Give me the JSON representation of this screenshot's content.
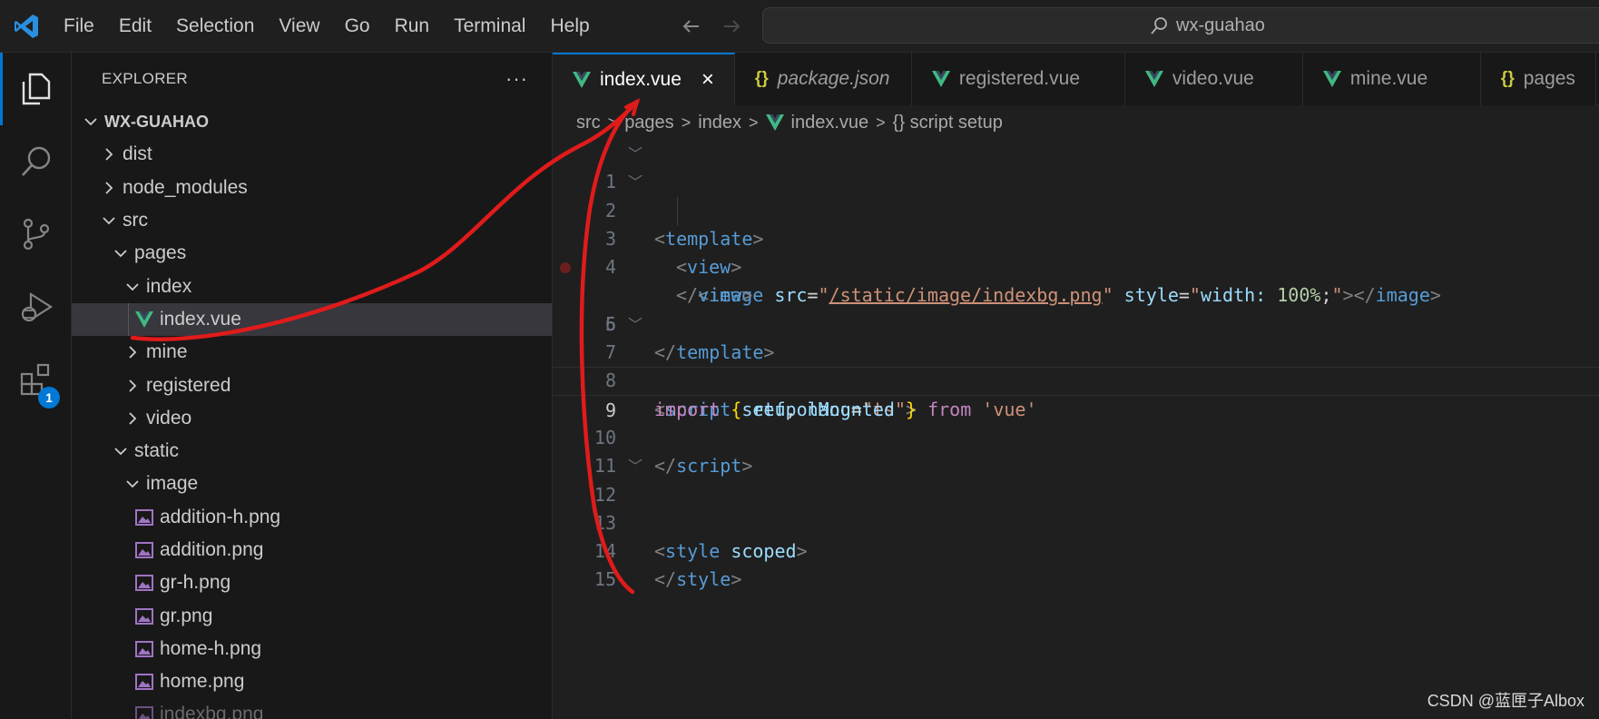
{
  "menu": [
    "File",
    "Edit",
    "Selection",
    "View",
    "Go",
    "Run",
    "Terminal",
    "Help"
  ],
  "search": {
    "label": "wx-guahao"
  },
  "activity": {
    "extensions_badge": "1"
  },
  "explorer": {
    "title": "EXPLORER",
    "more": "···",
    "root": "WX-GUAHAO",
    "items": [
      {
        "label": "dist"
      },
      {
        "label": "node_modules"
      },
      {
        "label": "src"
      },
      {
        "label": "pages"
      },
      {
        "label": "index"
      },
      {
        "label": "index.vue"
      },
      {
        "label": "mine"
      },
      {
        "label": "registered"
      },
      {
        "label": "video"
      },
      {
        "label": "static"
      },
      {
        "label": "image"
      },
      {
        "label": "addition-h.png"
      },
      {
        "label": "addition.png"
      },
      {
        "label": "gr-h.png"
      },
      {
        "label": "gr.png"
      },
      {
        "label": "home-h.png"
      },
      {
        "label": "home.png"
      },
      {
        "label": "indexbg.png"
      }
    ]
  },
  "tabs": [
    {
      "label": "index.vue",
      "icon": "vue-icon"
    },
    {
      "label": "package.json",
      "icon": "json-icon"
    },
    {
      "label": "registered.vue",
      "icon": "vue-icon"
    },
    {
      "label": "video.vue",
      "icon": "vue-icon"
    },
    {
      "label": "mine.vue",
      "icon": "vue-icon"
    },
    {
      "label": "pages",
      "icon": "json-icon"
    }
  ],
  "json_icon_glyph": "{}",
  "breadcrumb": [
    "src",
    "pages",
    "index",
    "index.vue",
    "{} script setup"
  ],
  "code": {
    "line_numbers": [
      "1",
      "2",
      "3",
      "4",
      "5",
      "6",
      "7",
      "8",
      "9",
      "10",
      "11",
      "12",
      "13",
      "14",
      "15"
    ],
    "l1": [
      "<",
      "template",
      ">"
    ],
    "l2": [
      "<",
      "view",
      ">"
    ],
    "l3": [
      "<",
      "image",
      "src",
      "=",
      "\"",
      "/static/image/indexbg.png",
      "\"",
      "style",
      "=",
      "\"",
      "width: ",
      "100%",
      ";",
      "\"",
      "></",
      "image",
      ">"
    ],
    "l4": [
      "</",
      "view",
      ">"
    ],
    "l5": [
      "</",
      "template",
      ">"
    ],
    "l7": [
      "<",
      "script",
      "setup",
      "lang",
      "=",
      "\"ts\"",
      ">"
    ],
    "l8": [
      "import",
      "{",
      "ref",
      ",",
      "onMounted",
      "}",
      "from",
      "'vue'"
    ],
    "l10": [
      "</",
      "script",
      ">"
    ],
    "l12": [
      "<",
      "style",
      "scoped",
      ">"
    ],
    "l14": [
      "</",
      "style",
      ">"
    ]
  },
  "watermark": "CSDN @蓝匣子Albox",
  "colors": {
    "accent": "#0078d4",
    "annotation": "#e01b1b",
    "vue_green": "#41b883"
  }
}
